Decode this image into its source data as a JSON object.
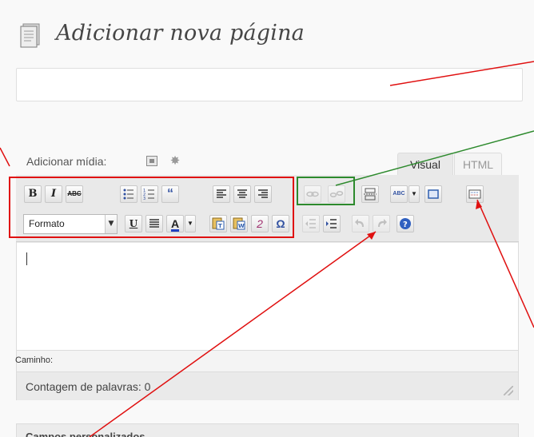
{
  "header": {
    "title": "Adicionar nova página",
    "icon": "page-icon"
  },
  "title_input": {
    "value": "",
    "placeholder": ""
  },
  "media": {
    "label": "Adicionar mídia:",
    "icons": [
      "image-icon",
      "media-star-icon"
    ]
  },
  "tabs": [
    {
      "label": "Visual",
      "active": true
    },
    {
      "label": "HTML",
      "active": false
    }
  ],
  "toolbar": {
    "row1": {
      "bold": "B",
      "italic": "I",
      "strikethrough": "ABC",
      "blockquote": "“",
      "spellcheck": "ABC"
    },
    "row2": {
      "format_select": "Formato",
      "format_arrow": "▼",
      "underline": "U",
      "text_color": "A",
      "text_color_arrow": "▼",
      "remove_format": "2",
      "special_char": "Ω"
    }
  },
  "editor": {
    "path_label": "Caminho:",
    "word_count": "Contagem de palavras: 0"
  },
  "custom_fields": {
    "label": "Campos personalizados"
  },
  "colors": {
    "annotation_red": "#e01010",
    "annotation_green": "#2d8a2d",
    "editor_bg": "#e9e9e9"
  }
}
